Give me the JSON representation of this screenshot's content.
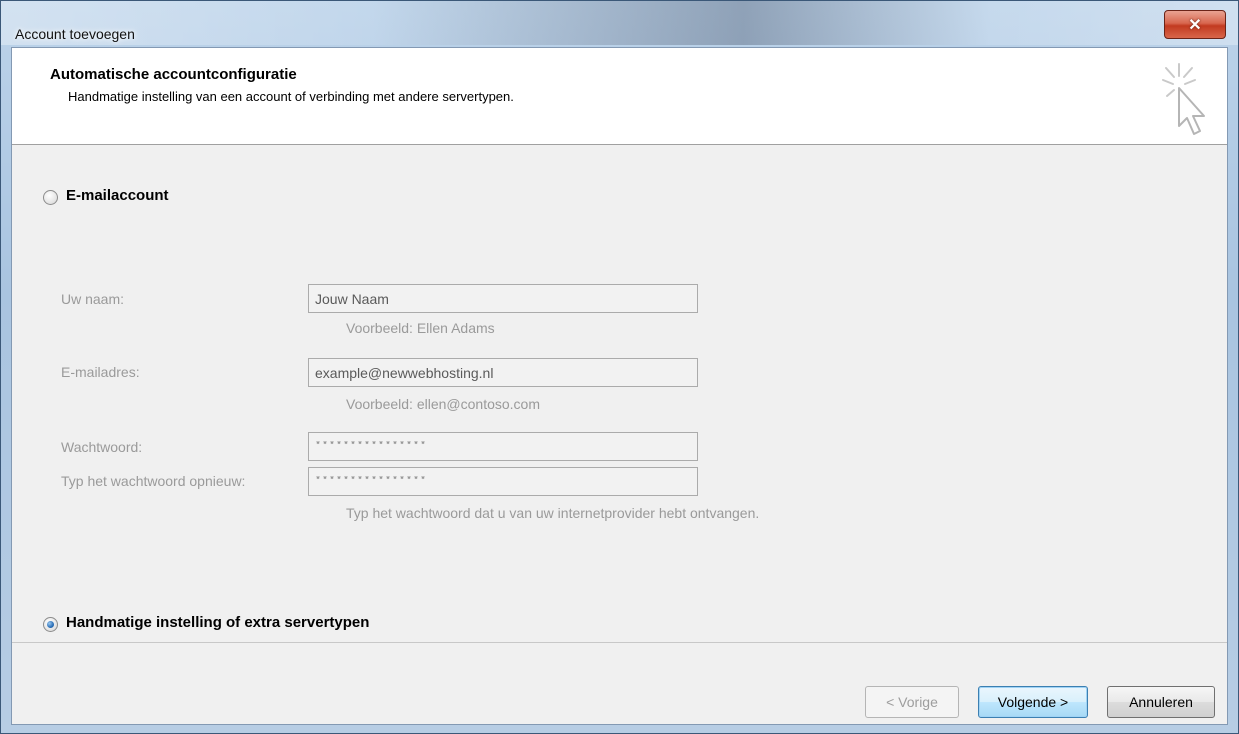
{
  "window": {
    "title": "Account toevoegen",
    "close_glyph": "✕"
  },
  "header": {
    "title": "Automatische accountconfiguratie",
    "subtitle": "Handmatige instelling van een account of verbinding met andere servertypen.",
    "icon": "cursor-click-icon"
  },
  "email_option": {
    "label": "E-mailaccount",
    "selected": false
  },
  "form": {
    "name_label": "Uw naam:",
    "name_value": "Jouw Naam",
    "name_hint": "Voorbeeld: Ellen Adams",
    "email_label": "E-mailadres:",
    "email_value": "example@newwebhosting.nl",
    "email_hint": "Voorbeeld: ellen@contoso.com",
    "password_label": "Wachtwoord:",
    "password_value": "****************",
    "password_repeat_label": "Typ het wachtwoord opnieuw:",
    "password_repeat_value": "****************",
    "password_hint": "Typ het wachtwoord dat u van uw internetprovider hebt ontvangen."
  },
  "manual_option": {
    "label": "Handmatige instelling of extra servertypen",
    "selected": true
  },
  "buttons": {
    "back": "< Vorige",
    "next": "Volgende >",
    "cancel": "Annuleren"
  },
  "colors": {
    "dialog_bg": "#f0f0f0",
    "header_bg": "#ffffff",
    "disabled_text": "#9a9a9a",
    "default_button_border": "#3c7fb1"
  }
}
